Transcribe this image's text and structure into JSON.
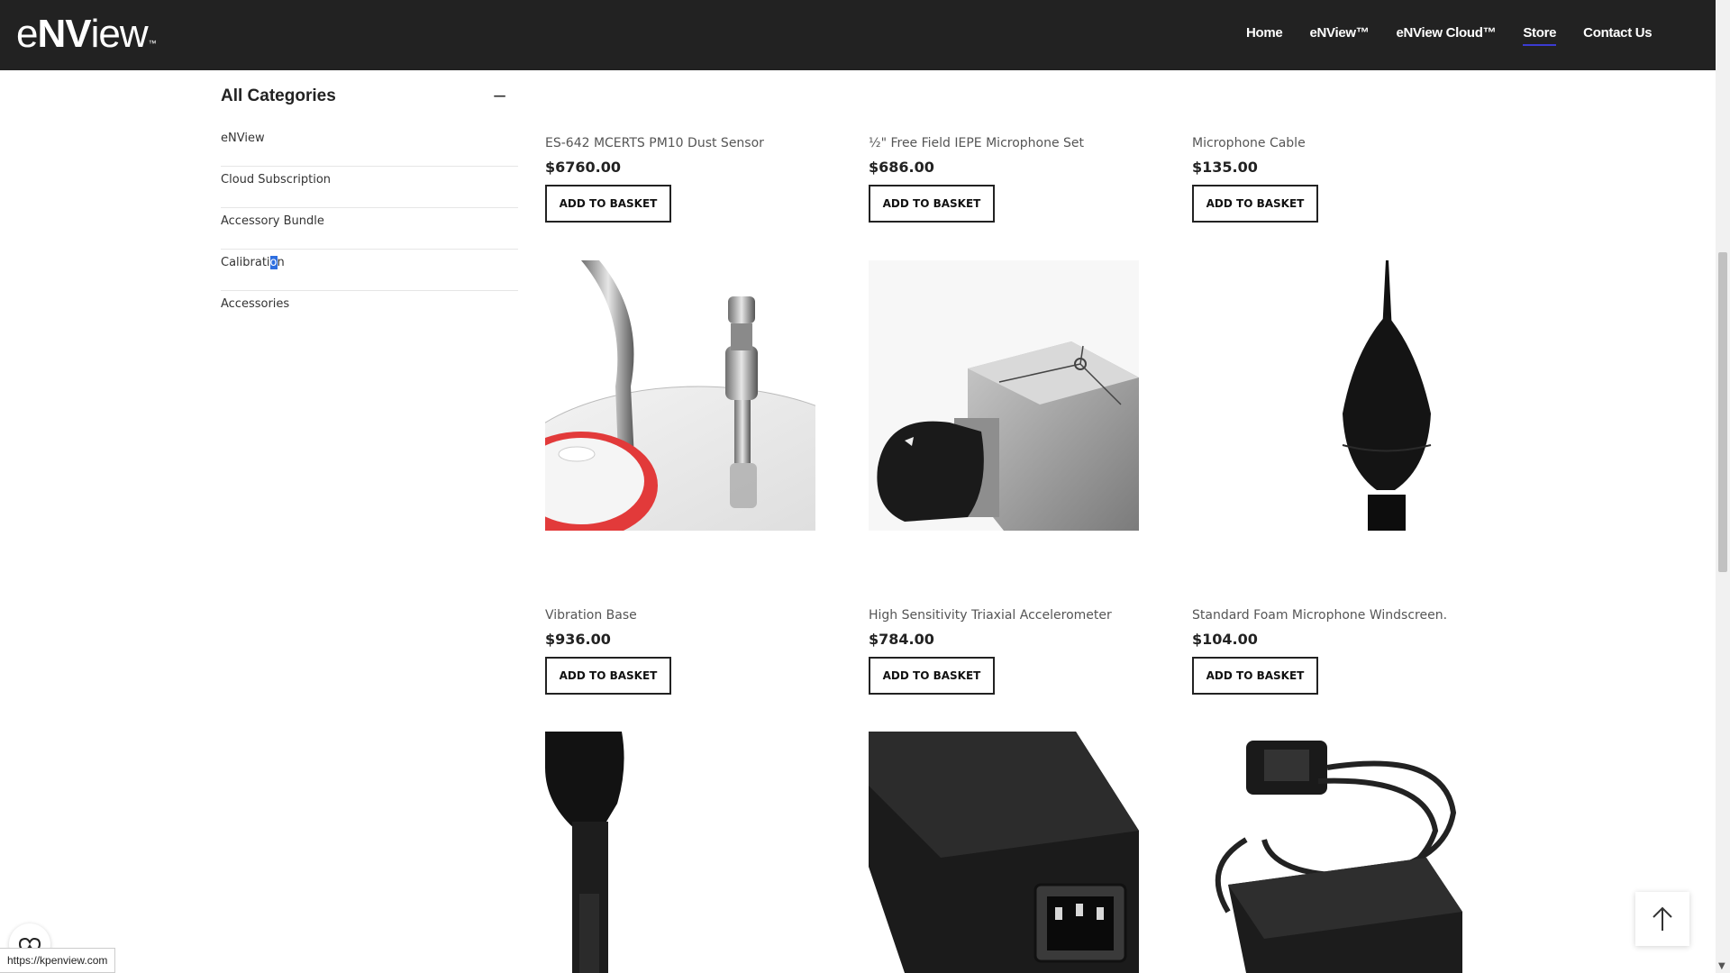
{
  "header": {
    "logo_prefix": "e",
    "logo_bold": "NV",
    "logo_suffix": "iew",
    "logo_tm": "™",
    "nav": [
      "Home",
      "eNView™",
      "eNView Cloud™",
      "Store",
      "Contact Us"
    ],
    "active_nav": "Store",
    "background": "#222222",
    "active_underline_color": "#3b3bd1"
  },
  "sidebar": {
    "title": "All Categories",
    "toggle": "−",
    "items": [
      "eNView",
      "Cloud Subscription",
      "Accessory Bundle",
      "Calibration",
      "Accessories"
    ]
  },
  "products": [
    {
      "name": "ES-642 MCERTS PM10 Dust Sensor",
      "price": "$6760.00",
      "button": "ADD TO BASKET"
    },
    {
      "name": "½\" Free Field IEPE Microphone Set",
      "price": "$686.00",
      "button": "ADD TO BASKET"
    },
    {
      "name": "Microphone Cable",
      "price": "$135.00",
      "button": "ADD TO BASKET"
    },
    {
      "name": "Vibration Base",
      "price": "$936.00",
      "button": "ADD TO BASKET"
    },
    {
      "name": "High Sensitivity Triaxial Accelerometer",
      "price": "$784.00",
      "button": "ADD TO BASKET"
    },
    {
      "name": "Standard Foam Microphone Windscreen.",
      "price": "$104.00",
      "button": "ADD TO BASKET"
    }
  ],
  "status_url": "https://kpenview.com",
  "icons": {
    "back_to_top": "arrow-up-icon",
    "cookie": "cookie-settings-icon"
  }
}
